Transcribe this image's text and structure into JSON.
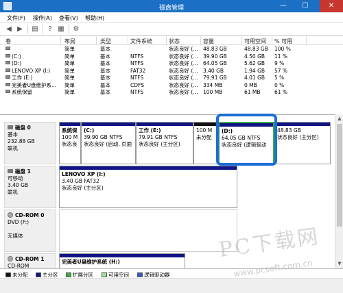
{
  "window": {
    "title": "磁盘管理",
    "minimize": "—",
    "maximize": "☐",
    "close": "✕"
  },
  "menu": [
    "文件(F)",
    "操作(A)",
    "查看(V)",
    "帮助(H)"
  ],
  "table": {
    "headers": [
      "卷",
      "布局",
      "类型",
      "文件系统",
      "状态",
      "容量",
      "可用空间",
      "% 可用"
    ],
    "rows": [
      [
        "",
        "简单",
        "基本",
        "",
        "状态良好 (...",
        "48.83 GB",
        "48.83 GB",
        "100 %"
      ],
      [
        "(C:)",
        "简单",
        "基本",
        "NTFS",
        "状态良好 (...",
        "39.90 GB",
        "4.50 GB",
        "11 %"
      ],
      [
        "(D:)",
        "简单",
        "基本",
        "NTFS",
        "状态良好 (...",
        "64.05 GB",
        "5.62 GB",
        "9 %"
      ],
      [
        "LENOVO XP (I:)",
        "简单",
        "基本",
        "FAT32",
        "状态良好 (...",
        "3.40 GB",
        "1.94 GB",
        "57 %"
      ],
      [
        "工作 (E:)",
        "简单",
        "基本",
        "NTFS",
        "状态良好 (...",
        "79.91 GB",
        "4.01 GB",
        "5 %"
      ],
      [
        "完美者U盘维护系...",
        "简单",
        "基本",
        "CDFS",
        "状态良好 (...",
        "334 MB",
        "0 MB",
        "0 %"
      ],
      [
        "系统保留",
        "简单",
        "基本",
        "NTFS",
        "状态良好 (...",
        "100 MB",
        "61 MB",
        "61 %"
      ]
    ]
  },
  "disks": [
    {
      "name": "磁盘 0",
      "type": "基本",
      "size": "232.88 GB",
      "status": "联机",
      "partitions": [
        {
          "name": "系统保",
          "l1": "100 M",
          "l2": "状态良"
        },
        {
          "name": "(C:)",
          "l1": "39.90 GB NTFS",
          "l2": "状态良好 (启动, 页面"
        },
        {
          "name": "工作  (E:)",
          "l1": "79.91 GB NTFS",
          "l2": "状态良好 (主分区)"
        },
        {
          "name": "",
          "l1": "100 M",
          "l2": "未分配"
        },
        {
          "name": "(D:)",
          "l1": "64.05 GB NTFS",
          "l2": "状态良好 (逻辑驱动"
        },
        {
          "name": "",
          "l1": "48.83 GB",
          "l2": "状态良好 (主分区)"
        }
      ]
    },
    {
      "name": "磁盘 1",
      "type": "可移动",
      "size": "3.40 GB",
      "status": "联机",
      "partitions": [
        {
          "name": "LENOVO XP  (I:)",
          "l1": "3.40 GB FAT32",
          "l2": "状态良好 (主分区)"
        }
      ]
    },
    {
      "name": "CD-ROM 0",
      "type": "DVD (F:)",
      "size": "",
      "status": "无媒体",
      "partitions": []
    },
    {
      "name": "CD-ROM 1",
      "type": "CD-ROM",
      "size": "",
      "status": "",
      "partitions": [
        {
          "name": "完美者U盘维护系统  (H:)",
          "l1": "",
          "l2": ""
        }
      ]
    }
  ],
  "legend": [
    "未分配",
    "主分区",
    "扩展分区",
    "可用空间",
    "逻辑驱动器"
  ],
  "legend_colors": [
    "#111111",
    "#101585",
    "#3eac3e",
    "#9ddf9d",
    "#3a58c8"
  ],
  "watermark": {
    "main": "PC下载网",
    "url": "www.pcsoft.com.cn"
  }
}
